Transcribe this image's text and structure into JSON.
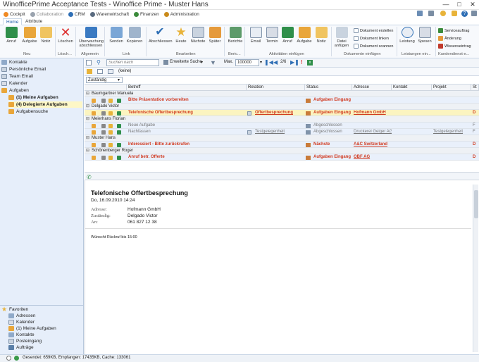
{
  "window": {
    "title": "WinofficePrime Acceptance Tests - Winoffice Prime - Muster Hans"
  },
  "topnav": {
    "items": [
      {
        "label": "Cockpit",
        "color": "#f08a24"
      },
      {
        "label": "Collaboration",
        "color": "#9aa3ae"
      },
      {
        "label": "CRM",
        "color": "#2f6fb5"
      },
      {
        "label": "Warenwirtschaft",
        "color": "#5a6b80"
      },
      {
        "label": "Finanzen",
        "color": "#3b8b3b"
      },
      {
        "label": "Administration",
        "color": "#c98a1a"
      }
    ]
  },
  "tabs": {
    "home": "Home",
    "attribute": "Attribute"
  },
  "ribbon": {
    "anruf": "Anruf",
    "aufgabe": "Aufgabe",
    "notiz": "Notiz",
    "loeschen": "Löschen",
    "ueberwachung": "Überwachung",
    "abschliessen_sub": "abschliessen",
    "senden": "Senden",
    "kopieren": "Kopieren",
    "abschliessen": "Abschliessen",
    "heute": "Heute",
    "naechste": "Nächste",
    "spaeter": "Später",
    "berichte": "Berichte",
    "email": "Email",
    "termin": "Termin",
    "anruf2": "Anruf",
    "aufgabe2": "Aufgabe",
    "notiz2": "Notiz",
    "datei_anfuegen": "Datei anfügen",
    "dok_erstellen": "Dokument erstellen",
    "dok_linken": "Dokument linken",
    "dok_scannen": "Dokument scannen",
    "leistung": "Leistung",
    "spesen": "Spesen",
    "serviceauftrag": "Serviceauftrag",
    "aenderung": "Änderung",
    "wissenseintrag": "Wissenseintrag",
    "groups": {
      "neu": "Neu",
      "loesch": "Lösch...",
      "allgemein": "Allgemein",
      "link": "Link",
      "bearbeiten": "Bearbeiten",
      "beric": "Beric...",
      "aktivitaeten": "Aktivitäten einfügen",
      "dokumente": "Dokumente einfügen",
      "leistungen": "Leistungen ein...",
      "kundendienst": "Kundendienst e..."
    }
  },
  "leftnav": {
    "kontakte": "Kontakte",
    "persoenliche_email": "Persönliche Email",
    "team_email": "Team Email",
    "kalender": "Kalender",
    "aufgaben": "Aufgaben",
    "meine_aufgaben": "(1) Meine Aufgaben",
    "delegierte_aufgaben": "(4) Delegierte Aufgaben",
    "aufgabensuche": "Aufgabensuche",
    "favoriten": "Favoriten",
    "fav": [
      "Adressen",
      "Kalender",
      "(1) Meine Aufgaben",
      "Kontakte",
      "Posteingang",
      "Aufträge"
    ]
  },
  "toolbar": {
    "search_placeholder": "Suchen nach",
    "erweiterte_suche": "Erweiterte Suche",
    "max_label": "Max.",
    "max_value": "100000",
    "page": "2/6",
    "filter_value": "(keine)"
  },
  "groupby": {
    "value": "Zuständig"
  },
  "grid": {
    "columns": [
      "Betreff",
      "Relation",
      "Status",
      "Adresse",
      "Kontakt",
      "Projekt",
      "St"
    ],
    "groups": [
      {
        "name": "Baumgartner Manuela",
        "rows": [
          {
            "betreff": "Bitte Präsentation vorbereiten",
            "relation": "",
            "status": "Aufgaben Eingang",
            "adresse": "",
            "projekt": "",
            "st": "",
            "style": "red"
          }
        ]
      },
      {
        "name": "Delgado Victor",
        "rows": [
          {
            "betreff": "Telefonische Offertbesprechung",
            "relation": "Offertbesprechung",
            "status": "Aufgaben Eingang",
            "adresse": "Hofmann GmbH",
            "projekt": "",
            "st": "D",
            "style": "red"
          }
        ]
      },
      {
        "name": "Meierhans Florian",
        "rows": [
          {
            "betreff": "Neue Aufgabe",
            "relation": "",
            "status": "Abgeschlossen",
            "adresse": "",
            "projekt": "",
            "st": "F",
            "style": "gray"
          },
          {
            "betreff": "Nachfassen",
            "relation": "Testgelegenheit",
            "status": "Abgeschlossen",
            "adresse": "Druckerei Geiger AG",
            "projekt": "Testgelegenheit",
            "st": "F",
            "style": "gray"
          }
        ]
      },
      {
        "name": "Muster Hans",
        "rows": [
          {
            "betreff": "Interessiert - Bitte zurückrufen",
            "relation": "",
            "status": "Nächste",
            "adresse": "A&C Switzerland",
            "projekt": "",
            "st": "D",
            "style": "red"
          }
        ]
      },
      {
        "name": "Schönenberger Roger",
        "rows": [
          {
            "betreff": "Anruf betr. Offerte",
            "relation": "",
            "status": "Aufgaben Eingang",
            "adresse": "OBF AG",
            "projekt": "",
            "st": "D",
            "style": "red"
          }
        ]
      }
    ]
  },
  "preview": {
    "title": "Telefonische Offertbesprechung",
    "date": "Do, 16.09.2010 14:24",
    "adresse_label": "Adresse:",
    "adresse_value": "Hofmann GmbH",
    "zustaendig_label": "Zuständig:",
    "zustaendig_value": "Delgado Victor",
    "an_label": "An:",
    "an_value": "061 827 12 38",
    "note": "Wünscht Rückruf bis 15:00"
  },
  "statusbar": {
    "text": "Gesendet: 659KB, Empfangen: 17435KB, Cache: 133061"
  }
}
